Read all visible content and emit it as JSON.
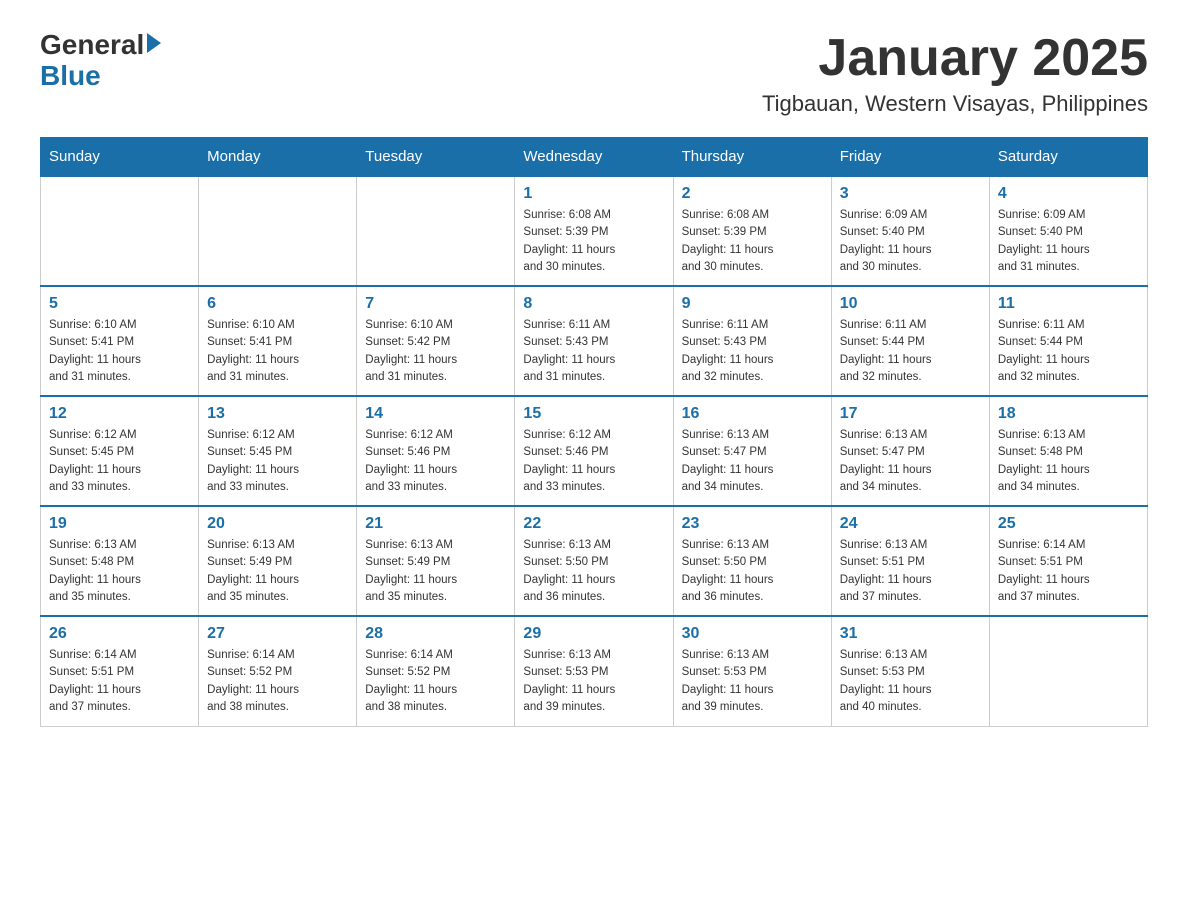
{
  "header": {
    "logo_general": "General",
    "logo_blue": "Blue",
    "month_title": "January 2025",
    "location": "Tigbauan, Western Visayas, Philippines"
  },
  "weekdays": [
    "Sunday",
    "Monday",
    "Tuesday",
    "Wednesday",
    "Thursday",
    "Friday",
    "Saturday"
  ],
  "weeks": [
    [
      {
        "day": "",
        "info": ""
      },
      {
        "day": "",
        "info": ""
      },
      {
        "day": "",
        "info": ""
      },
      {
        "day": "1",
        "info": "Sunrise: 6:08 AM\nSunset: 5:39 PM\nDaylight: 11 hours\nand 30 minutes."
      },
      {
        "day": "2",
        "info": "Sunrise: 6:08 AM\nSunset: 5:39 PM\nDaylight: 11 hours\nand 30 minutes."
      },
      {
        "day": "3",
        "info": "Sunrise: 6:09 AM\nSunset: 5:40 PM\nDaylight: 11 hours\nand 30 minutes."
      },
      {
        "day": "4",
        "info": "Sunrise: 6:09 AM\nSunset: 5:40 PM\nDaylight: 11 hours\nand 31 minutes."
      }
    ],
    [
      {
        "day": "5",
        "info": "Sunrise: 6:10 AM\nSunset: 5:41 PM\nDaylight: 11 hours\nand 31 minutes."
      },
      {
        "day": "6",
        "info": "Sunrise: 6:10 AM\nSunset: 5:41 PM\nDaylight: 11 hours\nand 31 minutes."
      },
      {
        "day": "7",
        "info": "Sunrise: 6:10 AM\nSunset: 5:42 PM\nDaylight: 11 hours\nand 31 minutes."
      },
      {
        "day": "8",
        "info": "Sunrise: 6:11 AM\nSunset: 5:43 PM\nDaylight: 11 hours\nand 31 minutes."
      },
      {
        "day": "9",
        "info": "Sunrise: 6:11 AM\nSunset: 5:43 PM\nDaylight: 11 hours\nand 32 minutes."
      },
      {
        "day": "10",
        "info": "Sunrise: 6:11 AM\nSunset: 5:44 PM\nDaylight: 11 hours\nand 32 minutes."
      },
      {
        "day": "11",
        "info": "Sunrise: 6:11 AM\nSunset: 5:44 PM\nDaylight: 11 hours\nand 32 minutes."
      }
    ],
    [
      {
        "day": "12",
        "info": "Sunrise: 6:12 AM\nSunset: 5:45 PM\nDaylight: 11 hours\nand 33 minutes."
      },
      {
        "day": "13",
        "info": "Sunrise: 6:12 AM\nSunset: 5:45 PM\nDaylight: 11 hours\nand 33 minutes."
      },
      {
        "day": "14",
        "info": "Sunrise: 6:12 AM\nSunset: 5:46 PM\nDaylight: 11 hours\nand 33 minutes."
      },
      {
        "day": "15",
        "info": "Sunrise: 6:12 AM\nSunset: 5:46 PM\nDaylight: 11 hours\nand 33 minutes."
      },
      {
        "day": "16",
        "info": "Sunrise: 6:13 AM\nSunset: 5:47 PM\nDaylight: 11 hours\nand 34 minutes."
      },
      {
        "day": "17",
        "info": "Sunrise: 6:13 AM\nSunset: 5:47 PM\nDaylight: 11 hours\nand 34 minutes."
      },
      {
        "day": "18",
        "info": "Sunrise: 6:13 AM\nSunset: 5:48 PM\nDaylight: 11 hours\nand 34 minutes."
      }
    ],
    [
      {
        "day": "19",
        "info": "Sunrise: 6:13 AM\nSunset: 5:48 PM\nDaylight: 11 hours\nand 35 minutes."
      },
      {
        "day": "20",
        "info": "Sunrise: 6:13 AM\nSunset: 5:49 PM\nDaylight: 11 hours\nand 35 minutes."
      },
      {
        "day": "21",
        "info": "Sunrise: 6:13 AM\nSunset: 5:49 PM\nDaylight: 11 hours\nand 35 minutes."
      },
      {
        "day": "22",
        "info": "Sunrise: 6:13 AM\nSunset: 5:50 PM\nDaylight: 11 hours\nand 36 minutes."
      },
      {
        "day": "23",
        "info": "Sunrise: 6:13 AM\nSunset: 5:50 PM\nDaylight: 11 hours\nand 36 minutes."
      },
      {
        "day": "24",
        "info": "Sunrise: 6:13 AM\nSunset: 5:51 PM\nDaylight: 11 hours\nand 37 minutes."
      },
      {
        "day": "25",
        "info": "Sunrise: 6:14 AM\nSunset: 5:51 PM\nDaylight: 11 hours\nand 37 minutes."
      }
    ],
    [
      {
        "day": "26",
        "info": "Sunrise: 6:14 AM\nSunset: 5:51 PM\nDaylight: 11 hours\nand 37 minutes."
      },
      {
        "day": "27",
        "info": "Sunrise: 6:14 AM\nSunset: 5:52 PM\nDaylight: 11 hours\nand 38 minutes."
      },
      {
        "day": "28",
        "info": "Sunrise: 6:14 AM\nSunset: 5:52 PM\nDaylight: 11 hours\nand 38 minutes."
      },
      {
        "day": "29",
        "info": "Sunrise: 6:13 AM\nSunset: 5:53 PM\nDaylight: 11 hours\nand 39 minutes."
      },
      {
        "day": "30",
        "info": "Sunrise: 6:13 AM\nSunset: 5:53 PM\nDaylight: 11 hours\nand 39 minutes."
      },
      {
        "day": "31",
        "info": "Sunrise: 6:13 AM\nSunset: 5:53 PM\nDaylight: 11 hours\nand 40 minutes."
      },
      {
        "day": "",
        "info": ""
      }
    ]
  ]
}
